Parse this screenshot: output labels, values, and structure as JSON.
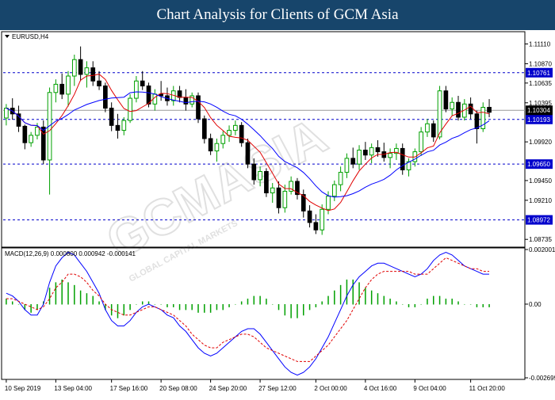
{
  "header": {
    "title": "Chart Analysis for Clients of GCM Asia"
  },
  "watermark": {
    "text": "GCMASIA",
    "sub": "GLOBAL CAPITAL MARKETS"
  },
  "chart_data": [
    {
      "type": "candlestick",
      "symbol_label": "EURUSD,H4",
      "ylim": [
        1.0866,
        1.1124
      ],
      "y_ticks": [
        {
          "value": 1.1111,
          "label": "1.11110"
        },
        {
          "value": 1.1087,
          "label": "1.10870"
        },
        {
          "value": 1.10635,
          "label": "1.10635"
        },
        {
          "value": 1.10395,
          "label": "1.10395"
        },
        {
          "value": 1.0992,
          "label": "1.09920"
        },
        {
          "value": 1.0945,
          "label": "1.09450"
        },
        {
          "value": 1.0921,
          "label": "1.09210"
        },
        {
          "value": 1.08735,
          "label": "1.08735"
        }
      ],
      "levels": [
        {
          "value": 1.10761,
          "label": "1.10761"
        },
        {
          "value": 1.10193,
          "label": "1.10193"
        },
        {
          "value": 1.0965,
          "label": "1.09650"
        },
        {
          "value": 1.08972,
          "label": "1.08972"
        }
      ],
      "current_price": {
        "value": 1.10304,
        "label": "1.10304"
      },
      "x_labels": [
        "10 Sep 2019",
        "13 Sep 04:00",
        "17 Sep 16:00",
        "20 Sep 08:00",
        "24 Sep 20:00",
        "27 Sep 12:00",
        "2 Oct 00:00",
        "4 Oct 16:00",
        "9 Oct 04:00",
        "11 Oct 20:00"
      ],
      "colors": {
        "up": "#00a000",
        "down": "#000000",
        "fast_ma": "#e00000",
        "slow_ma": "#0000ff",
        "levels": "#0000cc"
      },
      "ohlc": [
        [
          1.1021,
          1.1038,
          1.1012,
          1.1033
        ],
        [
          1.1033,
          1.1045,
          1.1019,
          1.1026
        ],
        [
          1.1026,
          1.1036,
          1.1004,
          1.1011
        ],
        [
          1.1011,
          1.1013,
          1.0983,
          1.0991
        ],
        [
          1.0991,
          1.1004,
          1.0986,
          1.1
        ],
        [
          1.1,
          1.1015,
          1.0995,
          1.101
        ],
        [
          1.101,
          1.1018,
          1.0965,
          1.097
        ],
        [
          1.097,
          1.1058,
          1.0928,
          1.1052
        ],
        [
          1.1052,
          1.1068,
          1.104,
          1.1062
        ],
        [
          1.1062,
          1.1075,
          1.1044,
          1.105
        ],
        [
          1.105,
          1.1078,
          1.1035,
          1.1072
        ],
        [
          1.1072,
          1.1098,
          1.106,
          1.1092
        ],
        [
          1.1092,
          1.1108,
          1.1066,
          1.1074
        ],
        [
          1.1074,
          1.109,
          1.1058,
          1.1082
        ],
        [
          1.1082,
          1.109,
          1.106,
          1.1066
        ],
        [
          1.1066,
          1.1078,
          1.1055,
          1.106
        ],
        [
          1.106,
          1.1064,
          1.1028,
          1.1033
        ],
        [
          1.1033,
          1.104,
          1.1005,
          1.1012
        ],
        [
          1.1012,
          1.1026,
          1.0996,
          1.1006
        ],
        [
          1.1006,
          1.1022,
          1.1,
          1.1018
        ],
        [
          1.1018,
          1.105,
          1.1015,
          1.1045
        ],
        [
          1.1045,
          1.1072,
          1.104,
          1.1066
        ],
        [
          1.1066,
          1.1078,
          1.1055,
          1.106
        ],
        [
          1.106,
          1.1064,
          1.1034,
          1.1038
        ],
        [
          1.1038,
          1.1056,
          1.103,
          1.105
        ],
        [
          1.105,
          1.1066,
          1.1042,
          1.1048
        ],
        [
          1.1048,
          1.1058,
          1.1036,
          1.1042
        ],
        [
          1.1042,
          1.106,
          1.1036,
          1.1054
        ],
        [
          1.1054,
          1.106,
          1.104,
          1.1046
        ],
        [
          1.1046,
          1.1056,
          1.103,
          1.1038
        ],
        [
          1.1038,
          1.1052,
          1.1034,
          1.1048
        ],
        [
          1.1048,
          1.1052,
          1.1015,
          1.102
        ],
        [
          1.102,
          1.1024,
          1.099,
          1.0996
        ],
        [
          1.0996,
          1.1002,
          1.0976,
          1.0981
        ],
        [
          1.0981,
          1.0996,
          1.0968,
          1.099
        ],
        [
          1.099,
          1.1005,
          1.0984,
          1.1
        ],
        [
          1.1,
          1.1012,
          1.0992,
          1.1006
        ],
        [
          1.1006,
          1.1018,
          1.1,
          1.1012
        ],
        [
          1.1012,
          1.1016,
          1.0986,
          1.0991
        ],
        [
          1.0991,
          1.0996,
          1.096,
          1.0965
        ],
        [
          1.0965,
          1.0972,
          1.094,
          1.0946
        ],
        [
          1.0946,
          1.0962,
          1.0938,
          1.0956
        ],
        [
          1.0956,
          1.096,
          1.0925,
          1.093
        ],
        [
          1.093,
          1.0942,
          1.0918,
          1.0936
        ],
        [
          1.0936,
          1.0944,
          1.0905,
          1.0912
        ],
        [
          1.0912,
          1.094,
          1.0906,
          1.0932
        ],
        [
          1.0932,
          1.095,
          1.0928,
          1.0944
        ],
        [
          1.0944,
          1.0948,
          1.0922,
          1.0928
        ],
        [
          1.0928,
          1.0934,
          1.09,
          1.0908
        ],
        [
          1.0908,
          1.0915,
          1.0888,
          1.0894
        ],
        [
          1.0894,
          1.0904,
          1.088,
          1.0885
        ],
        [
          1.0885,
          1.0916,
          1.0879,
          1.091
        ],
        [
          1.091,
          1.0932,
          1.0904,
          1.0926
        ],
        [
          1.0926,
          1.0945,
          1.092,
          1.094
        ],
        [
          1.094,
          1.0962,
          1.0932,
          1.0955
        ],
        [
          1.0955,
          1.0978,
          1.0948,
          1.0972
        ],
        [
          1.0972,
          1.0985,
          1.096,
          1.0965
        ],
        [
          1.0965,
          1.0988,
          1.0958,
          1.0982
        ],
        [
          1.0982,
          1.0992,
          1.097,
          1.0976
        ],
        [
          1.0976,
          1.099,
          1.0966,
          1.0985
        ],
        [
          1.0985,
          1.0994,
          1.0974,
          1.098
        ],
        [
          1.098,
          1.0991,
          1.0968,
          1.0973
        ],
        [
          1.0973,
          1.0984,
          1.096,
          1.0978
        ],
        [
          1.0978,
          1.099,
          1.097,
          1.0984
        ],
        [
          1.0984,
          1.099,
          1.0952,
          1.0958
        ],
        [
          1.0958,
          1.0972,
          1.095,
          1.0968
        ],
        [
          1.0968,
          1.0984,
          1.0962,
          1.098
        ],
        [
          1.098,
          1.101,
          1.0975,
          1.1004
        ],
        [
          1.1004,
          1.102,
          1.0998,
          1.1014
        ],
        [
          1.1014,
          1.1018,
          1.0992,
          1.0998
        ],
        [
          1.0998,
          1.106,
          1.0995,
          1.1054
        ],
        [
          1.1054,
          1.106,
          1.1028,
          1.1032
        ],
        [
          1.1032,
          1.1046,
          1.1024,
          1.104
        ],
        [
          1.104,
          1.1048,
          1.1018,
          1.1022
        ],
        [
          1.1022,
          1.1044,
          1.1018,
          1.1038
        ],
        [
          1.1038,
          1.1046,
          1.102,
          1.1026
        ],
        [
          1.1026,
          1.103,
          1.099,
          1.1008
        ],
        [
          1.1008,
          1.104,
          1.1004,
          1.1034
        ],
        [
          1.1034,
          1.1044,
          1.1022,
          1.1028
        ]
      ]
    },
    {
      "type": "bar",
      "label": "MACD(12,26,9) 0.000800 0.000942 -0.000141",
      "ylim": [
        -0.002699,
        0.002001
      ],
      "y_ticks": [
        {
          "value": 0.002001,
          "label": "0.002001"
        },
        {
          "value": 0.0,
          "label": "0.00"
        },
        {
          "value": -0.002699,
          "label": "-0.002699"
        }
      ],
      "colors": {
        "histogram": "#00a000",
        "macd": "#0000ff",
        "signal": "#e00000"
      },
      "histogram": [
        0.0002,
        0.0001,
        0.0,
        -0.0002,
        -0.0003,
        -0.0002,
        0.0001,
        0.0006,
        0.0008,
        0.0009,
        0.0008,
        0.0007,
        0.0005,
        0.0004,
        0.0003,
        0.0001,
        -0.0002,
        -0.0004,
        -0.0005,
        -0.0004,
        -0.0002,
        0.0,
        0.0001,
        0.0001,
        0.0,
        0.0,
        -0.0001,
        -0.0001,
        -0.0002,
        -0.0002,
        -0.0002,
        -0.0003,
        -0.0003,
        -0.0003,
        -0.0002,
        -0.0002,
        -0.0001,
        0.0,
        0.0001,
        0.0002,
        0.0003,
        0.0003,
        0.0002,
        0.0,
        -0.0002,
        -0.0004,
        -0.0005,
        -0.0005,
        -0.0004,
        -0.0002,
        -0.0001,
        0.0001,
        0.0003,
        0.0005,
        0.0007,
        0.0009,
        0.0009,
        0.0008,
        0.0006,
        0.0005,
        0.0004,
        0.0003,
        0.0002,
        0.0001,
        0.0,
        -0.0001,
        -0.0001,
        0.0,
        0.0002,
        0.0003,
        0.0003,
        0.0002,
        0.0002,
        0.0001,
        0.0,
        0.0,
        -0.0001,
        -0.0001,
        -0.0001
      ],
      "macd": [
        0.0004,
        0.0003,
        0.0001,
        -0.0002,
        -0.0004,
        -0.0004,
        0.0,
        0.0008,
        0.0014,
        0.0017,
        0.0019,
        0.0018,
        0.0015,
        0.0012,
        0.0008,
        0.0004,
        -0.0002,
        -0.0006,
        -0.0008,
        -0.0008,
        -0.0006,
        -0.0003,
        -0.0001,
        0.0,
        -0.0001,
        -0.0002,
        -0.0004,
        -0.0005,
        -0.0008,
        -0.001,
        -0.0013,
        -0.0016,
        -0.0018,
        -0.0019,
        -0.0018,
        -0.0016,
        -0.0014,
        -0.0012,
        -0.001,
        -0.0009,
        -0.0009,
        -0.0011,
        -0.0014,
        -0.0017,
        -0.002,
        -0.0023,
        -0.0025,
        -0.0026,
        -0.0025,
        -0.0023,
        -0.002,
        -0.0016,
        -0.0012,
        -0.0007,
        -0.0002,
        0.0003,
        0.0007,
        0.001,
        0.0012,
        0.0014,
        0.0015,
        0.0015,
        0.0014,
        0.0013,
        0.0012,
        0.0011,
        0.001,
        0.0011,
        0.0013,
        0.0016,
        0.0018,
        0.0019,
        0.0018,
        0.0016,
        0.0014,
        0.0013,
        0.0012,
        0.0011,
        0.0011
      ],
      "signal": [
        0.0002,
        0.0002,
        0.0001,
        0.0,
        -0.0001,
        -0.0002,
        -0.0001,
        0.0002,
        0.0006,
        0.0008,
        0.0011,
        0.0011,
        0.001,
        0.0008,
        0.0005,
        0.0003,
        0.0,
        -0.0002,
        -0.0003,
        -0.0004,
        -0.0004,
        -0.0003,
        -0.0002,
        -0.0001,
        -0.0001,
        -0.0002,
        -0.0003,
        -0.0004,
        -0.0006,
        -0.0008,
        -0.0011,
        -0.0013,
        -0.0015,
        -0.0016,
        -0.0016,
        -0.0014,
        -0.0013,
        -0.0012,
        -0.0011,
        -0.0011,
        -0.0012,
        -0.0014,
        -0.0016,
        -0.0017,
        -0.0018,
        -0.0019,
        -0.002,
        -0.0021,
        -0.0021,
        -0.0021,
        -0.0019,
        -0.0017,
        -0.0015,
        -0.0012,
        -0.0009,
        -0.0006,
        -0.0002,
        0.0002,
        0.0006,
        0.0009,
        0.0011,
        0.0012,
        0.0012,
        0.0012,
        0.0012,
        0.0012,
        0.0011,
        0.0011,
        0.0011,
        0.0013,
        0.0015,
        0.0017,
        0.0016,
        0.0015,
        0.0014,
        0.0013,
        0.0013,
        0.0012,
        0.0012
      ]
    }
  ]
}
